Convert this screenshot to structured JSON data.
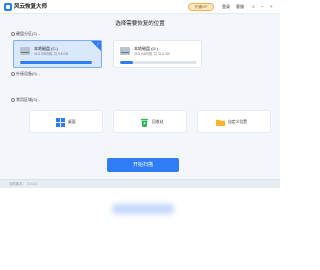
{
  "app": {
    "name": "风云恢复大师",
    "vip_label": "开通VIP",
    "menu": [
      "登录",
      "客服"
    ],
    "window_controls": [
      "≡",
      "–",
      "×"
    ]
  },
  "page_title": "选择需要恢复的位置",
  "sections": {
    "disk_label": "硬盘分区(2)",
    "external_label": "外接设备(0)",
    "common_label": "常用区域(3)"
  },
  "disks": [
    {
      "name": "本地磁盘 (C:)",
      "space": "41.5 GB可用, 共 9.8 GB",
      "usage": 0.94,
      "selected": true
    },
    {
      "name": "本地磁盘 (D:)",
      "space": "29.6 GB可用, 共 31.6 GB",
      "usage": 0.17,
      "selected": false
    }
  ],
  "locations": [
    {
      "label": "桌面",
      "icon": "windows-icon"
    },
    {
      "label": "回收站",
      "icon": "recycle-bin-icon"
    },
    {
      "label": "自定义位置",
      "icon": "folder-icon"
    }
  ],
  "start_button": "开始扫描",
  "footer": {
    "version": "当前版本：  2.0.0.0"
  },
  "colors": {
    "accent": "#2f7cf6",
    "recycle": "#2fb85b",
    "folder": "#f5b431"
  }
}
